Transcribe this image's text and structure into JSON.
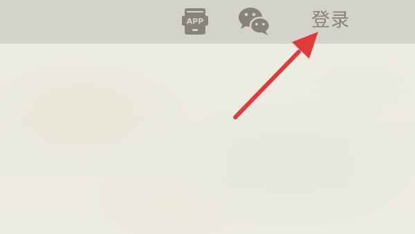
{
  "header": {
    "app_icon_text": "APP",
    "app_icon": "phone-app-icon",
    "wechat_icon": "wechat-icon",
    "login_label": "登录"
  },
  "annotation": {
    "type": "arrow",
    "color": "#e03a3a",
    "target": "login-link"
  },
  "colors": {
    "header_bg": "#d4d3cb",
    "icon_color": "#86847a",
    "page_bg": "#ecebe2"
  }
}
